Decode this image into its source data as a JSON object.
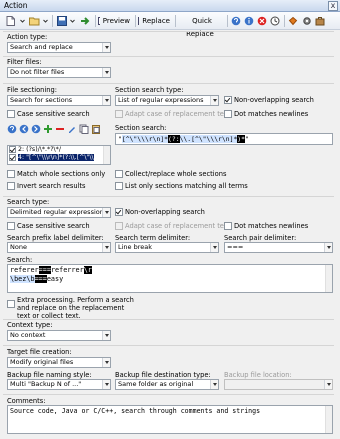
{
  "window": {
    "title": "Action",
    "close_glyph": "x"
  },
  "toolbar": {
    "preview": "Preview",
    "replace": "Replace",
    "quick_replace": "Quick Replace"
  },
  "action_type": {
    "label": "Action type:",
    "value": "Search and replace"
  },
  "filter_files": {
    "label": "Filter files:",
    "value": "Do not filter files"
  },
  "file_sectioning": {
    "label": "File sectioning:",
    "value": "Search for sections",
    "case_sensitive": "Case sensitive search"
  },
  "section_search_type": {
    "label": "Section search type:",
    "value": "List of regular expressions",
    "non_overlapping": "Non-overlapping search",
    "adapt_case": "Adapt case of replacement text",
    "dot_newlines": "Dot matches newlines"
  },
  "section_search": {
    "label": "Section search:",
    "text": "\"[^\\\"\\\\\\r\\n]*(?:\\\\.[^\\\"\\\\\\r\\n]*)*\"",
    "parts": [
      "\"",
      "[^\\\"\\\\\\r\\n]*",
      "(?:",
      "\\\\.",
      "[^\\\"\\\\\\r\\n]*",
      ")*",
      "\""
    ]
  },
  "section_list": {
    "items": [
      "2: (?s)/\\*.*?\\*/",
      "4: \"[^\\\"\\\\\\r\\n]*(?:\\\\.[^\\\"\\\\"
    ]
  },
  "section_options": {
    "match_whole": "Match whole sections only",
    "collect_replace": "Collect/replace whole sections",
    "invert": "Invert search results",
    "list_only": "List only sections matching all terms"
  },
  "search_type": {
    "label": "Search type:",
    "value": "Delimited regular expressions",
    "non_overlapping": "Non-overlapping search",
    "case_sensitive": "Case sensitive search",
    "adapt_case": "Adapt case of replacement text",
    "dot_newlines": "Dot matches newlines"
  },
  "delimiters": {
    "prefix_label": "Search prefix label delimiter:",
    "prefix_value": "None",
    "term_label": "Search term delimiter:",
    "term_value": "Line break",
    "pair_label": "Search pair delimiter:",
    "pair_value": "==="
  },
  "search": {
    "label": "Search:",
    "line1a": "referer",
    "line1b": "===",
    "line1c": "referrer",
    "line1d": "\\r",
    "line2a": "\\bez\\b",
    "line2b": "===",
    "line2c": "easy"
  },
  "extra_processing": {
    "text1": "Extra processing. Perform a search",
    "text2": "and replace on the replacement",
    "text3": "text or collect text."
  },
  "context_type": {
    "label": "Context type:",
    "value": "No context"
  },
  "target_file": {
    "label": "Target file creation:",
    "value": "Modify original files"
  },
  "backup": {
    "naming_label": "Backup file naming style:",
    "naming_value": "Multi \"Backup N of ...\"",
    "dest_label": "Backup file destination type:",
    "dest_value": "Same folder as original",
    "location_label": "Backup file location:",
    "location_value": ""
  },
  "comments": {
    "label": "Comments:",
    "text": "Source code, Java or C/C++, search through comments and strings"
  }
}
